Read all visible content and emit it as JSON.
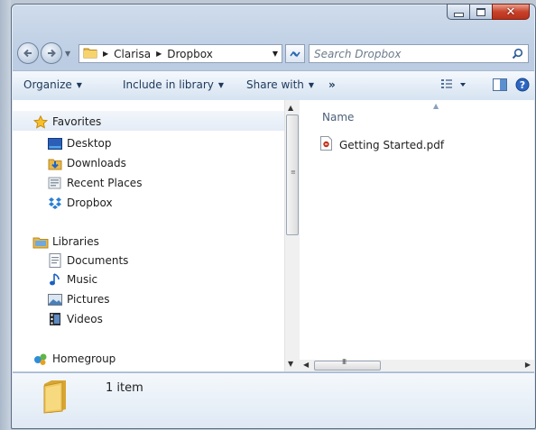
{
  "window": {
    "caption_buttons": [
      "minimize",
      "maximize",
      "close"
    ]
  },
  "address_bar": {
    "path": [
      "Clarisa",
      "Dropbox"
    ]
  },
  "search": {
    "placeholder": "Search Dropbox"
  },
  "toolbar": {
    "organize": "Organize",
    "include_in_library": "Include in library",
    "share_with": "Share with",
    "overflow": "»",
    "icons": [
      "views-icon",
      "preview-pane-icon",
      "help-icon"
    ]
  },
  "navigation": {
    "favorites": {
      "label": "Favorites",
      "items": [
        {
          "label": "Desktop",
          "icon": "desktop-icon"
        },
        {
          "label": "Downloads",
          "icon": "downloads-icon"
        },
        {
          "label": "Recent Places",
          "icon": "recent-places-icon"
        },
        {
          "label": "Dropbox",
          "icon": "dropbox-icon"
        }
      ]
    },
    "libraries": {
      "label": "Libraries",
      "items": [
        {
          "label": "Documents",
          "icon": "documents-icon"
        },
        {
          "label": "Music",
          "icon": "music-icon"
        },
        {
          "label": "Pictures",
          "icon": "pictures-icon"
        },
        {
          "label": "Videos",
          "icon": "videos-icon"
        }
      ]
    },
    "homegroup": {
      "label": "Homegroup"
    }
  },
  "file_list": {
    "column_name": "Name",
    "files": [
      {
        "name": "Getting Started.pdf",
        "icon": "pdf-file-icon"
      }
    ]
  },
  "details_pane": {
    "item_count": "1 item"
  },
  "scrollbar": {
    "h_thumb_grip": "III"
  },
  "colors": {
    "window_frame": "#bccde3",
    "close_button": "#c8422b",
    "toolbar_text": "#1e395b"
  }
}
